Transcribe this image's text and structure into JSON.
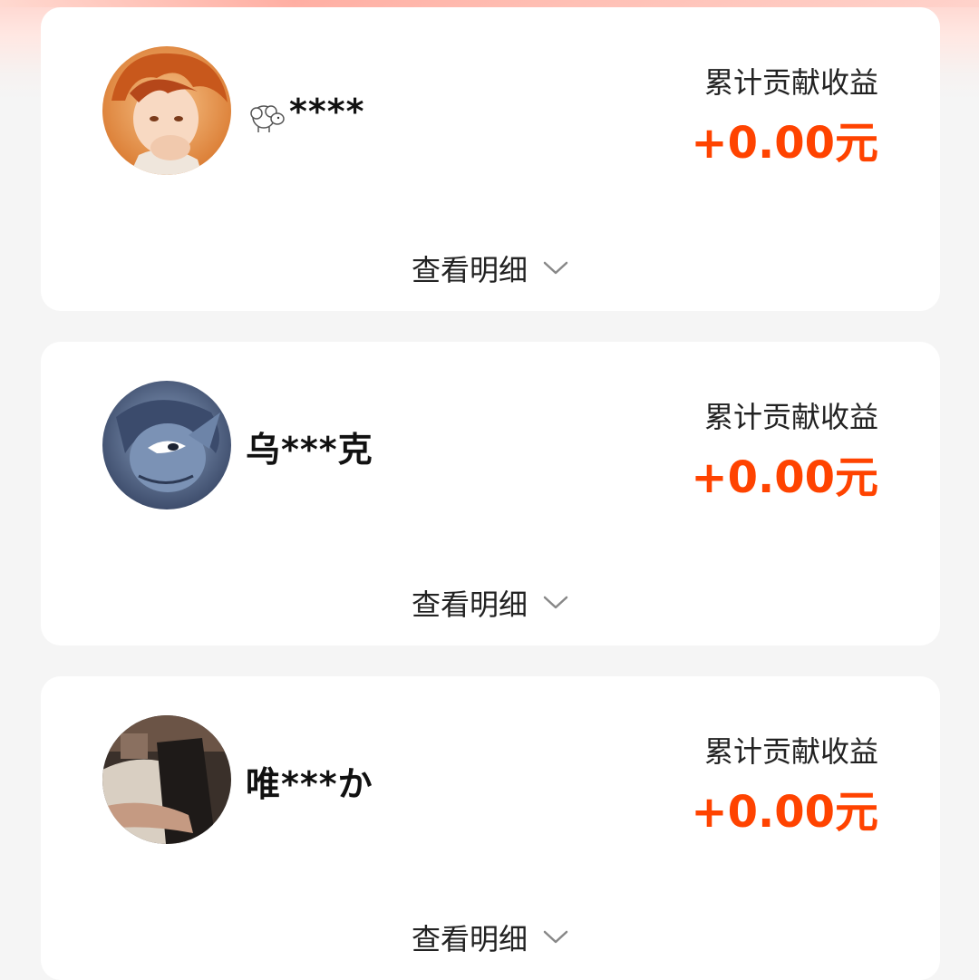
{
  "cards": [
    {
      "username": "****",
      "earn_label": "累计贡献收益",
      "earn_value": "+0.00元",
      "detail_label": "查看明细",
      "avatar_icon": "avatar-orange-hair",
      "name_icon": "sheep-icon"
    },
    {
      "username": "乌***克",
      "earn_label": "累计贡献收益",
      "earn_value": "+0.00元",
      "detail_label": "查看明细",
      "avatar_icon": "avatar-blue-anime"
    },
    {
      "username": "唯***か",
      "earn_label": "累计贡献收益",
      "earn_value": "+0.00元",
      "detail_label": "查看明细",
      "avatar_icon": "avatar-photo"
    }
  ],
  "colors": {
    "accent": "#ff4300",
    "card_bg": "#ffffff",
    "page_bg": "#f5f5f5"
  }
}
